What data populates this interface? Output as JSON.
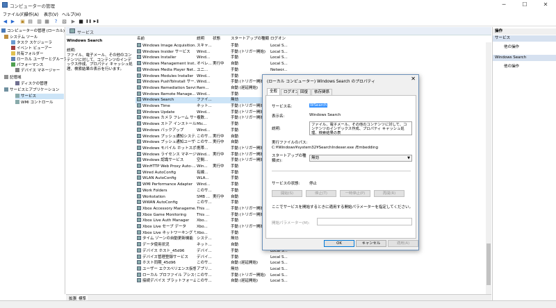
{
  "window": {
    "title": "コンピューターの管理",
    "controls": {
      "minimize": "─",
      "maximize": "☐",
      "close": "✕"
    }
  },
  "menu": [
    "ファイル(F)",
    "操作(A)",
    "表示(V)",
    "ヘルプ(H)"
  ],
  "toolbar": {
    "icons": [
      "back-icon",
      "forward-icon",
      "up-icon",
      "show-hide-tree-icon",
      "export-icon",
      "properties-icon",
      "help-icon",
      "refresh-icon",
      "play-icon",
      "stop-icon",
      "pause-icon",
      "restart-icon"
    ],
    "glyphs": [
      "◀",
      "▶",
      "▣",
      "▤",
      "▥",
      "▦",
      "?",
      "▧",
      "▶",
      "■",
      "❚❚",
      "▶❚"
    ]
  },
  "tree": [
    {
      "label": "コンピューターの管理 (ローカル)",
      "level": 0
    },
    {
      "label": "システム ツール",
      "level": 1
    },
    {
      "label": "タスク スケジューラ",
      "level": 2
    },
    {
      "label": "イベント ビューアー",
      "level": 2
    },
    {
      "label": "共有フォルダー",
      "level": 2
    },
    {
      "label": "ローカル ユーザーとグループ",
      "level": 2
    },
    {
      "label": "パフォーマンス",
      "level": 2
    },
    {
      "label": "デバイス マネージャー",
      "level": 2
    },
    {
      "label": "記憶域",
      "level": 1
    },
    {
      "label": "ディスクの管理",
      "level": 2
    },
    {
      "label": "サービスとアプリケーション",
      "level": 1
    },
    {
      "label": "サービス",
      "level": 2,
      "selected": true
    },
    {
      "label": "WMI コントロール",
      "level": 2
    }
  ],
  "center": {
    "header_title": "サービス",
    "selected_service": "Windows Search",
    "desc_label": "説明:",
    "description": "ファイル、電子メール、その他のコンテンツに対して、コンテンツのインデックス作成、プロパティ キャッシュ処理、検索結果の表示を行います。",
    "columns": [
      "名前",
      "説明",
      "状態",
      "スタートアップの種類",
      "ログオン"
    ]
  },
  "services": [
    [
      "Windows Image Acquisition...",
      "スキャ...",
      "",
      "手動",
      "Local S..."
    ],
    [
      "Windows Insider サービス",
      "Wind...",
      "",
      "手動 (トリガー開始)",
      "Local S..."
    ],
    [
      "Windows Installer",
      "Wind...",
      "",
      "手動",
      "Local S..."
    ],
    [
      "Windows Management Inst...",
      "オペレ...",
      "実行中",
      "自動",
      "Local S..."
    ],
    [
      "Windows Media Player Net...",
      "ユニ...",
      "",
      "手動",
      "Networ..."
    ],
    [
      "Windows Modules Installer",
      "Wind...",
      "",
      "手動",
      "Local S..."
    ],
    [
      "Windows PushToInstall サー...",
      "Wind...",
      "",
      "手動 (トリガー開始)",
      "Local S..."
    ],
    [
      "Windows Remediation Servi...",
      "Rem...",
      "",
      "自動 (遅延開始)",
      "Local S..."
    ],
    [
      "Windows Remote Manage...",
      "Wind...",
      "",
      "手動",
      "Networ..."
    ],
    [
      "Windows Search",
      "ファイ...",
      "",
      "無効",
      "Local S..."
    ],
    [
      "Windows Time",
      "ネット...",
      "",
      "手動 (トリガー開始)",
      "Local S..."
    ],
    [
      "Windows Update",
      "Wind...",
      "",
      "手動 (トリガー開始)",
      "Local S..."
    ],
    [
      "Windows カメラ フレーム サーバー",
      "複数...",
      "",
      "手動 (トリガー開始)",
      "Local S..."
    ],
    [
      "Windows ストア インストール サ...",
      "Mic...",
      "",
      "手動",
      "Local S..."
    ],
    [
      "Windows バックアップ",
      "Wind...",
      "",
      "手動",
      "Local S..."
    ],
    [
      "Windows プッシュ通知システ...",
      "このサ...",
      "実行中",
      "自動",
      "Local S..."
    ],
    [
      "Windows プッシュ通知ユーザー...",
      "このサ...",
      "実行中",
      "自動",
      "Local S..."
    ],
    [
      "Windows モバイル ホットスポ...",
      "携帯...",
      "",
      "手動 (トリガー開始)",
      "Local S..."
    ],
    [
      "Windows ライセンス マネージャ...",
      "Wind...",
      "実行中",
      "手動 (トリガー開始)",
      "Local S..."
    ],
    [
      "Windows 認識サービス",
      "空間...",
      "",
      "手動 (トリガー開始)",
      "Local S..."
    ],
    [
      "WinHTTP Web Proxy Auto-...",
      "Win...",
      "実行中",
      "手動",
      "Local S..."
    ],
    [
      "Wired AutoConfig",
      "有線...",
      "",
      "手動",
      "Local S..."
    ],
    [
      "WLAN AutoConfig",
      "WLA...",
      "",
      "手動",
      "Local S..."
    ],
    [
      "WMI Performance Adapter",
      "Wind...",
      "",
      "手動",
      "Local S..."
    ],
    [
      "Work Folders",
      "このサ...",
      "",
      "手動",
      "Local S..."
    ],
    [
      "Workstation",
      "SMB ...",
      "実行中",
      "自動",
      "Networ..."
    ],
    [
      "WWAN AutoConfig",
      "このサ...",
      "",
      "手動",
      "Local S..."
    ],
    [
      "Xbox Accessory Manageme...",
      "This ...",
      "",
      "手動 (トリガー開始)",
      "Local S..."
    ],
    [
      "Xbox Game Monitoring",
      "This ...",
      "",
      "手動 (トリガー開始)",
      "Local S..."
    ],
    [
      "Xbox Live Auth Manager",
      "Xbo...",
      "",
      "手動",
      "Local S..."
    ],
    [
      "Xbox Live セーブ データ",
      "Xbo...",
      "",
      "手動 (トリガー開始)",
      "Local S..."
    ],
    [
      "Xbox Live ネットワーキング サー...",
      "Xbo...",
      "",
      "手動",
      "Local S..."
    ],
    [
      "タイム ゾーンの自動更新機能",
      "システ...",
      "",
      "無効",
      "Local S..."
    ],
    [
      "データ使用状況",
      "ネット...",
      "",
      "自動",
      "Local S..."
    ],
    [
      "デバイス ホスト_45d96",
      "デバイ...",
      "",
      "手動",
      "Local S..."
    ],
    [
      "デバイス管理登録サービス",
      "デバイ...",
      "",
      "手動",
      "Local S..."
    ],
    [
      "ホスト同期_45d96",
      "このサ...",
      "",
      "自動 (遅延開始)",
      "Local S..."
    ],
    [
      "ユーザー エクスペリエンス仮想化...",
      "アプリ...",
      "",
      "無効",
      "Local S..."
    ],
    [
      "ローカル プロファイル アシスタン...",
      "このサ...",
      "",
      "手動 (トリガー開始)",
      "Local S..."
    ],
    [
      "接続デバイス プラットフォーム サ...",
      "このサ...",
      "",
      "自動 (遅延開始)",
      "Local S..."
    ]
  ],
  "tabs": [
    "拡張",
    "標準"
  ],
  "actions": {
    "sections": [
      {
        "title": "サービス",
        "items": [
          "他の操作"
        ]
      },
      {
        "title": "Windows Search",
        "items": [
          "他の操作"
        ]
      }
    ]
  },
  "dialog": {
    "title": "(ローカル コンピューター) Windows Search のプロパティ",
    "tabs": [
      "全般",
      "ログオン",
      "回復",
      "依存関係"
    ],
    "service_name_label": "サービス名:",
    "service_name": "WSearch",
    "display_name_label": "表示名:",
    "display_name": "Windows Search",
    "description_label": "説明:",
    "description": "ファイル、電子メール、その他のコンテンツに対して、コンテンツのインデックス作成、プロパティ キャッシュ処理、検索結果の表",
    "path_label": "実行ファイルのパス:",
    "path": "C:¥Windows¥system32¥SearchIndexer.exe /Embedding",
    "startup_label": "スタートアップの種類(E):",
    "startup_value": "無効",
    "status_label": "サービスの状態:",
    "status_value": "停止",
    "btn_start": "開始(S)",
    "btn_stop": "停止(T)",
    "btn_pause": "一時停止(P)",
    "btn_resume": "再開(R)",
    "hint": "ここでサービスを開始するときに適用する開始パラメーターを指定してください。",
    "param_label": "開始パラメーター(M):",
    "ok": "OK",
    "cancel": "キャンセル",
    "apply": "適用(A)"
  }
}
